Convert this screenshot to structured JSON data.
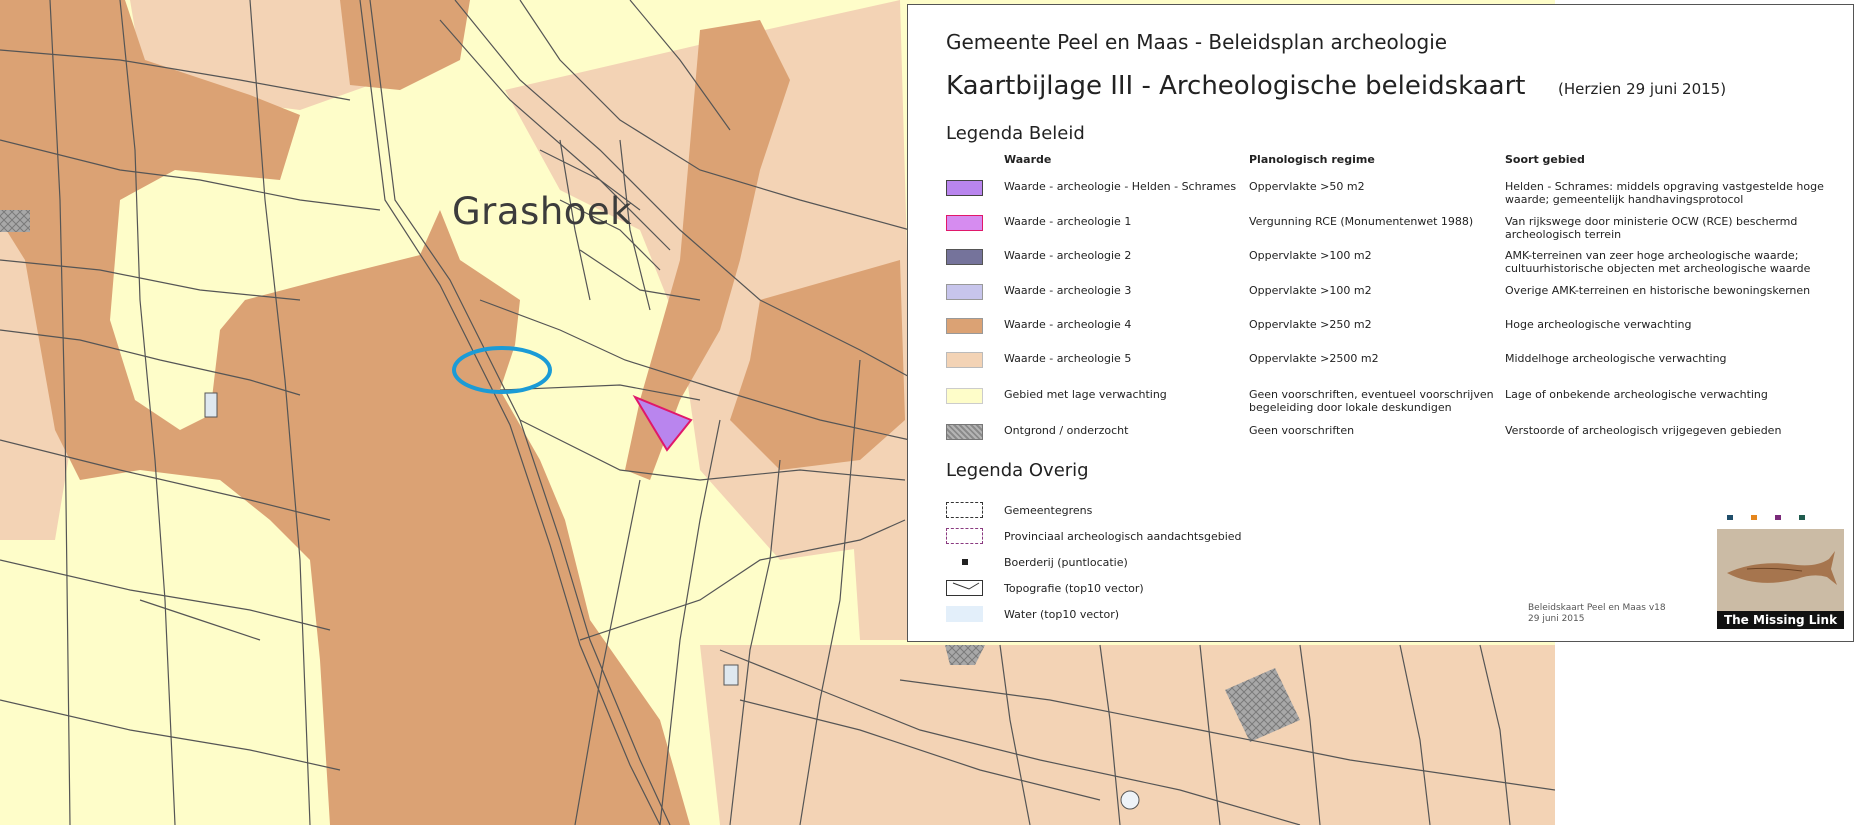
{
  "map": {
    "place_label": "Grashoek",
    "colors": {
      "high": "#dba274",
      "medium": "#f3d3b5",
      "low": "#fefdc9",
      "purple": "#b985ee",
      "grey_hatch": "#a4a4a4",
      "road": "#545454",
      "highlight_ellipse": "#1b9bd6"
    }
  },
  "legend": {
    "title1": "Gemeente Peel en Maas - Beleidsplan archeologie",
    "title2": "Kaartbijlage III - Archeologische beleidskaart",
    "revised": "(Herzien 29 juni 2015)",
    "beleid_heading": "Legenda Beleid",
    "columns": {
      "waarde": "Waarde",
      "regime": "Planologisch regime",
      "soort": "Soort gebied"
    },
    "rows": [
      {
        "waarde": "Waarde - archeologie - Helden - Schrames",
        "regime": "Oppervlakte >50 m2",
        "soort": "Helden - Schrames: middels opgraving vastgestelde hoge waarde; gemeentelijk handhavingsprotocol",
        "color": "#b985ee",
        "border": "#444444"
      },
      {
        "waarde": "Waarde - archeologie 1",
        "regime": "Vergunning RCE (Monumentenwet 1988)",
        "soort": "Van rijkswege door ministerie OCW (RCE) beschermd archeologisch terrein",
        "color": "#d68cf0",
        "border": "#e0186a"
      },
      {
        "waarde": "Waarde - archeologie 2",
        "regime": "Oppervlakte >100 m2",
        "soort": "AMK-terreinen van zeer hoge archeologische waarde; cultuurhistorische objecten met archeologische waarde",
        "color": "#75739b",
        "border": "#555555"
      },
      {
        "waarde": "Waarde - archeologie 3",
        "regime": "Oppervlakte >100 m2",
        "soort": "Overige AMK-terreinen en historische bewoningskernen",
        "color": "#c7c5ec",
        "border": "#999999"
      },
      {
        "waarde": "Waarde - archeologie 4",
        "regime": "Oppervlakte >250 m2",
        "soort": "Hoge archeologische verwachting",
        "color": "#dba274",
        "border": "#999999"
      },
      {
        "waarde": "Waarde - archeologie 5",
        "regime": "Oppervlakte >2500 m2",
        "soort": "Middelhoge archeologische verwachting",
        "color": "#f3d3b5",
        "border": "#bbbbbb"
      },
      {
        "waarde": "Gebied met lage verwachting",
        "regime": "Geen voorschriften, eventueel voorschrijven begeleiding door lokale deskundigen",
        "soort": "Lage of onbekende archeologische verwachting",
        "color": "#fefdc9",
        "border": "#cccccc"
      },
      {
        "waarde": "Ontgrond / onderzocht",
        "regime": "Geen voorschriften",
        "soort": "Verstoorde of archeologisch vrijgegeven gebieden",
        "color": "#a4a4a4",
        "border": "#777777"
      }
    ],
    "overig_heading": "Legenda Overig",
    "overig": [
      {
        "label": "Gemeentegrens",
        "style": "dash-black"
      },
      {
        "label": "Provinciaal archeologisch aandachtsgebied",
        "style": "dash-purple"
      },
      {
        "label": "Boerderij (puntlocatie)",
        "style": "point"
      },
      {
        "label": "Topografie (top10 vector)",
        "style": "topo"
      },
      {
        "label": "Water (top10 vector)",
        "style": "water"
      }
    ],
    "footer_line1": "Beleidskaart Peel en Maas v18",
    "footer_line2": "29 juni 2015",
    "logo_text": "The Missing Link",
    "logo_dot_colors": [
      "#1f4e6a",
      "#e5861d",
      "#7a2a7a",
      "#1f5b4e"
    ]
  }
}
